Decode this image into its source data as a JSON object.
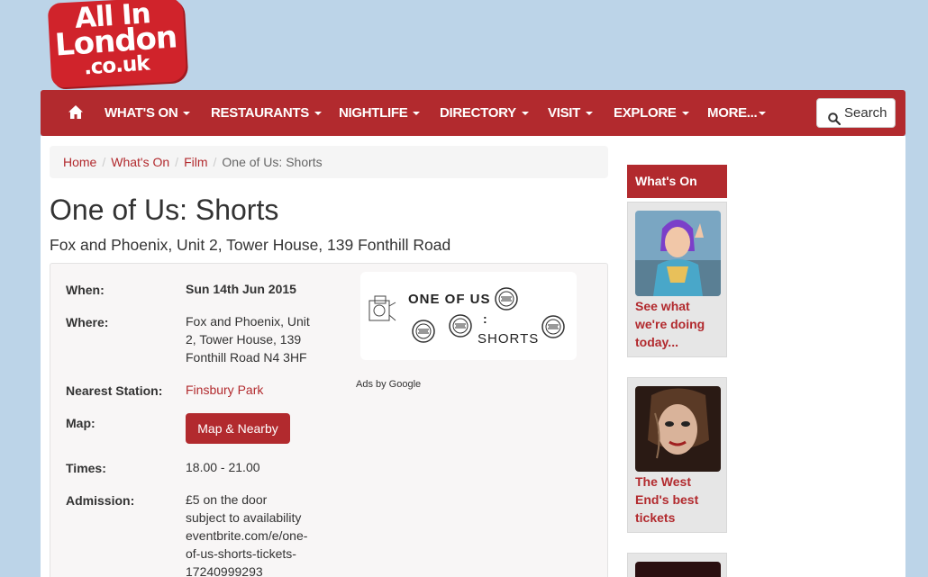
{
  "logo": {
    "line1": "All In",
    "line2": "London",
    "line3": ".co.uk"
  },
  "nav": {
    "home_icon": "home-icon",
    "items": [
      {
        "label": "WHAT'S ON"
      },
      {
        "label": "RESTAURANTS"
      },
      {
        "label": "NIGHTLIFE"
      },
      {
        "label": "DIRECTORY"
      },
      {
        "label": "VISIT"
      },
      {
        "label": "EXPLORE"
      },
      {
        "label": "MORE..."
      }
    ],
    "search_label": "Search",
    "search_icon": "search-icon"
  },
  "breadcrumb": [
    "Home",
    "What's On",
    "Film",
    "One of Us: Shorts"
  ],
  "event": {
    "title": "One of Us: Shorts",
    "venue": "Fox and Phoenix, Unit 2, Tower House, 139 Fonthill Road",
    "details": {
      "when_label": "When:",
      "when": "Sun 14th Jun 2015",
      "where_label": "Where:",
      "where": "Fox and Phoenix, Unit 2, Tower House, 139 Fonthill Road N4 3HF",
      "station_label": "Nearest Station:",
      "station": "Finsbury Park",
      "map_label": "Map:",
      "map_button": "Map & Nearby",
      "times_label": "Times:",
      "times": "18.00 - 21.00",
      "admission_label": "Admission:",
      "admission_lines": [
        "£5 on the door",
        "subject to availability",
        "eventbrite.com/e/one-",
        "of-us-shorts-tickets-",
        "17240999293"
      ]
    },
    "image": {
      "line1": "ONE OF US",
      "colon": ":",
      "line2": "SHORTS"
    },
    "ads_label": "Ads by Google"
  },
  "sidebar": {
    "heading": "What's On",
    "cards": [
      {
        "caption": "See what we're doing today..."
      },
      {
        "caption": "The West End's best tickets"
      }
    ]
  },
  "colors": {
    "brand_red": "#b22a2e",
    "page_bg": "#bcd4e8",
    "logo_red": "#d0232b"
  }
}
